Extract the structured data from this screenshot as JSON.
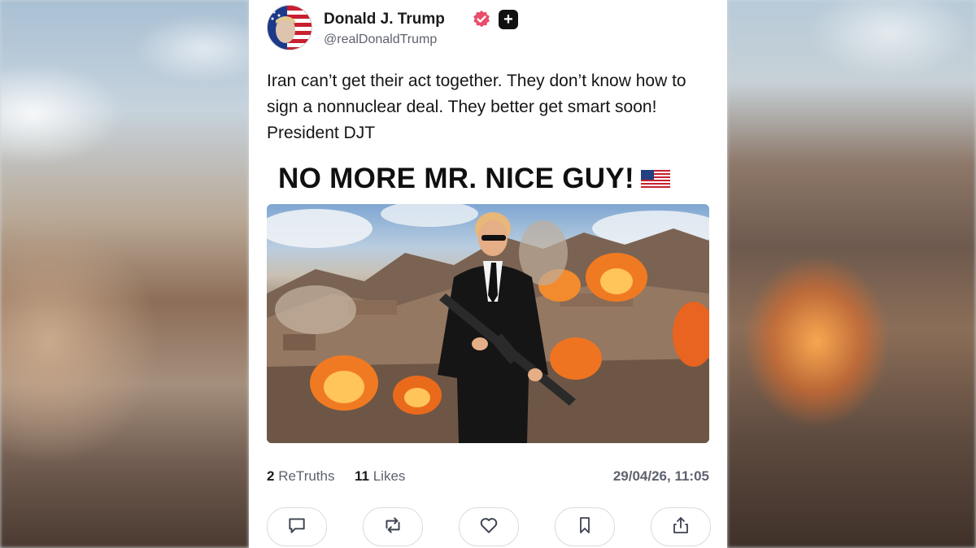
{
  "post": {
    "author_name": "Donald J. Trump",
    "handle": "@realDonaldTrump",
    "text": "Iran can’t get their act together. They don’t know how to sign a nonnuclear deal. They better get smart soon! President DJT",
    "headline": "NO MORE MR. NICE GUY!",
    "retruths_count": "2",
    "retruths_label": "ReTruths",
    "likes_count": "11",
    "likes_label": "Likes",
    "timestamp": "29/04/26, 11:05"
  },
  "icons": {
    "verified": "verified-badge-icon",
    "plus": "truth-plus-icon",
    "flag": "us-flag-icon",
    "reply": "reply-icon",
    "retruth": "retruth-icon",
    "like": "heart-icon",
    "bookmark": "bookmark-icon",
    "share": "share-icon"
  },
  "colors": {
    "verified": "#e94d6a",
    "text": "#151515",
    "muted": "#5e6270"
  }
}
